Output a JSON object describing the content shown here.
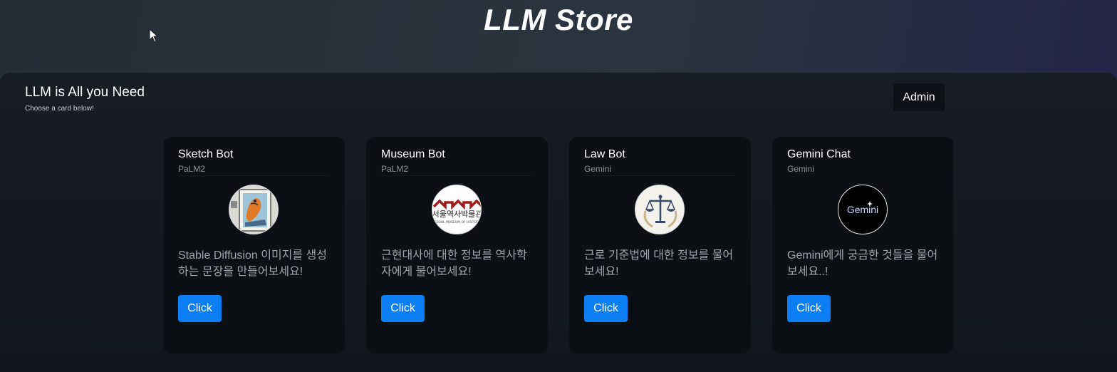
{
  "app": {
    "title": "LLM Store"
  },
  "panel": {
    "title": "LLM is All you Need",
    "subtitle": "Choose a card below!",
    "admin_label": "Admin"
  },
  "cards": [
    {
      "title": "Sketch Bot",
      "model": "PaLM2",
      "description": "Stable Diffusion 이미지를 생성하는 문장을 만들어보세요!",
      "button_label": "Click",
      "image": "sketch-painting"
    },
    {
      "title": "Museum Bot",
      "model": "PaLM2",
      "description": "근현대사에 대한 정보를 역사학자에게 물어보세요!",
      "button_label": "Click",
      "image": "museum-logo",
      "logo_text": "서울역사박물관",
      "logo_subtext": "SEOUL MUSEUM OF HISTORY"
    },
    {
      "title": "Law Bot",
      "model": "Gemini",
      "description": "근로 기준법에 대한 정보를 물어보세요!",
      "button_label": "Click",
      "image": "scales-of-justice"
    },
    {
      "title": "Gemini Chat",
      "model": "Gemini",
      "description": "Gemini에게 궁금한 것들을 물어보세요..!",
      "button_label": "Click",
      "image": "gemini-logo",
      "logo_text": "Gemini"
    }
  ],
  "colors": {
    "accent": "#0d7ff5",
    "card_bg": "#0c0f14",
    "panel_bg": "#161b22"
  }
}
